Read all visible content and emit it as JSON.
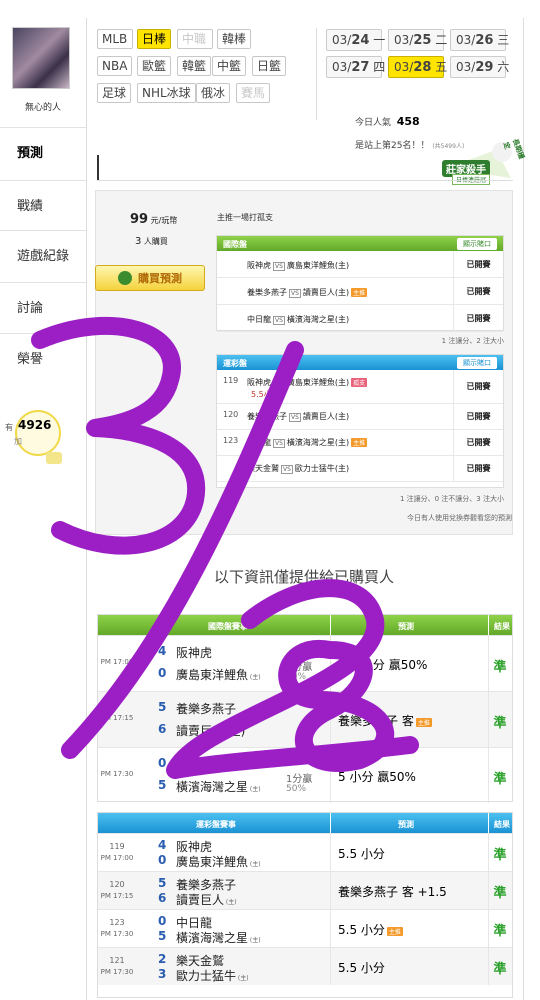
{
  "user": {
    "name": "無心的人"
  },
  "nav": [
    {
      "label": "預測",
      "active": true
    },
    {
      "label": "戰績"
    },
    {
      "label": "遊戲紀錄"
    },
    {
      "label": "討論"
    },
    {
      "label": "榮譽"
    }
  ],
  "left_extra": {
    "prefix": "有",
    "points": "4926",
    "suffix": "加"
  },
  "leagues": [
    {
      "label": "MLB"
    },
    {
      "label": "日棒",
      "selected": true
    },
    {
      "label": "中職",
      "disabled": true
    },
    {
      "label": "韓棒"
    },
    {
      "label": "NBA"
    },
    {
      "label": "歐籃"
    },
    {
      "label": "韓籃"
    },
    {
      "label": "中籃"
    },
    {
      "label": "日籃"
    },
    {
      "label": "足球"
    },
    {
      "label": "NHL冰球"
    },
    {
      "label": "俄冰"
    },
    {
      "label": "賽馬",
      "disabled": true
    }
  ],
  "dates": [
    {
      "md": "03/",
      "d": "24",
      "wd": "一"
    },
    {
      "md": "03/",
      "d": "25",
      "wd": "二"
    },
    {
      "md": "03/",
      "d": "26",
      "wd": "三"
    },
    {
      "md": "03/",
      "d": "27",
      "wd": "四"
    },
    {
      "md": "03/",
      "d": "28",
      "wd": "五",
      "selected": true
    },
    {
      "md": "03/",
      "d": "29",
      "wd": "六"
    }
  ],
  "popularity": {
    "label": "今日人氣",
    "value": "458",
    "rank": "是站上第25名！！",
    "rank_sub": "(共5499人)"
  },
  "badge": {
    "main": "莊家殺手",
    "sub": "日棒連莊冠",
    "ribbon": "長期穩定"
  },
  "purchase": {
    "price": "99",
    "unit": "元/玩幣",
    "buyers": "3",
    "buyers_label": "人購買",
    "button": "購買預測",
    "note": "主推一場打孤支"
  },
  "intl_panel": {
    "title": "國際盤",
    "show_btn": "顯示賭口",
    "rows": [
      {
        "away": "阪神虎",
        "home": "廣島東洋鯉魚(主)",
        "status": "已開賽"
      },
      {
        "away": "養樂多燕子",
        "home": "讀賣巨人(主)",
        "status": "已開賽",
        "mark": "主推"
      },
      {
        "away": "中日龍",
        "home": "橫濱海灣之星(主)",
        "status": "已開賽"
      }
    ],
    "footer": "1 注讓分、2 注大小"
  },
  "lottery_panel": {
    "title": "運彩盤",
    "show_btn": "顯示賭口",
    "rows": [
      {
        "no": "119",
        "away": "阪神虎",
        "home": "廣島東洋鯉魚(主)",
        "extra": "5.5小分",
        "status": "已開賽",
        "mark": "孤支"
      },
      {
        "no": "120",
        "away": "養樂多燕子",
        "home": "讀賣巨人(主)",
        "status": "已開賽"
      },
      {
        "no": "123",
        "away": "中日龍",
        "home": "橫濱海灣之星(主)",
        "status": "已開賽",
        "mark": "主推"
      },
      {
        "no": "",
        "away": "樂天金鷲",
        "home": "歐力士猛牛(主)",
        "status": "已開賽"
      }
    ],
    "footer": "1 注讓分、0 注不讓分、3 注大小",
    "note": "今日有人使用兌換券觀看您的預測"
  },
  "buyers_only": "以下資訊僅提供給已購買人",
  "intl_table": {
    "h1": "國際盤賽事",
    "h2": "預測",
    "h3": "結果",
    "rows": [
      {
        "time": "PM 17:00",
        "s1": "4",
        "t1": "阪神虎",
        "s2": "0",
        "t2": "廣島東洋鯉魚",
        "line": "1分贏",
        "pct": "50%",
        "pred": "5.5 小分 贏50%",
        "result": "準"
      },
      {
        "time": "PM 17:15",
        "s1": "5",
        "t1": "養樂多燕子",
        "s2": "6",
        "t2": "讀賣巨人(主)",
        "line": "",
        "pct": "",
        "pred": "養樂多燕子 客",
        "result": "準",
        "mark": "主推"
      },
      {
        "time": "PM 17:30",
        "s1": "0",
        "t1": "中日龍",
        "s2": "5",
        "t2": "橫濱海灣之星",
        "line": "1分贏",
        "pct": "50%",
        "pred": "5 小分 贏50%",
        "result": "準"
      }
    ]
  },
  "lottery_table": {
    "h1": "運彩盤賽事",
    "h2": "預測",
    "h3": "結果",
    "rows": [
      {
        "no": "119",
        "time": "PM 17:00",
        "s1": "4",
        "t1": "阪神虎",
        "s2": "0",
        "t2": "廣島東洋鯉魚",
        "pred": "5.5 小分",
        "result": "準"
      },
      {
        "no": "120",
        "time": "PM 17:15",
        "s1": "5",
        "t1": "養樂多燕子",
        "s2": "6",
        "t2": "讀賣巨人",
        "pred": "養樂多燕子 客 +1.5",
        "result": "準"
      },
      {
        "no": "123",
        "time": "PM 17:30",
        "s1": "0",
        "t1": "中日龍",
        "s2": "5",
        "t2": "橫濱海灣之星",
        "pred": "5.5 小分",
        "result": "準",
        "mark": "主推"
      },
      {
        "no": "121",
        "time": "PM 17:30",
        "s1": "2",
        "t1": "樂天金鷲",
        "s2": "3",
        "t2": "歐力士猛牛",
        "pred": "5.5 小分",
        "result": "準"
      }
    ]
  },
  "host_mark": "(主)",
  "overlay": {
    "text": "3/28",
    "color": "#9b1fc4"
  }
}
